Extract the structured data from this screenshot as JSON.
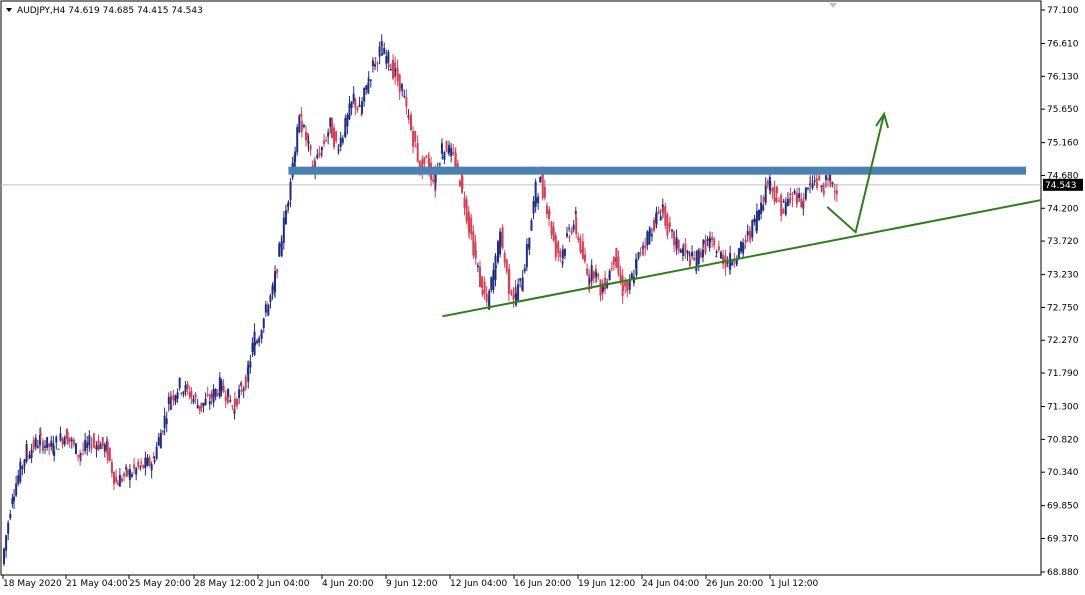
{
  "header": {
    "symbol_line": "AUDJPY,H4  74.619 74.685 74.415 74.543"
  },
  "chart_data": {
    "type": "candlestick",
    "symbol": "AUDJPY",
    "timeframe": "H4",
    "ohlc": {
      "open": 74.619,
      "high": 74.685,
      "low": 74.415,
      "close": 74.543
    },
    "current_price": 74.543,
    "current_price_label": "74.543",
    "y_ticks": [
      "77.100",
      "76.610",
      "76.130",
      "75.650",
      "75.160",
      "74.680",
      "74.200",
      "73.720",
      "73.230",
      "72.750",
      "72.270",
      "71.790",
      "71.300",
      "70.820",
      "70.340",
      "69.850",
      "69.370",
      "68.880"
    ],
    "ylim": [
      68.88,
      77.1
    ],
    "x_ticks": [
      "18 May 2020",
      "21 May 04:00",
      "25 May 20:00",
      "28 May 12:00",
      "2 Jun 04:00",
      "4 Jun 20:00",
      "9 Jun 12:00",
      "12 Jun 04:00",
      "16 Jun 20:00",
      "19 Jun 12:00",
      "24 Jun 04:00",
      "26 Jun 20:00",
      "1 Jul 12:00"
    ],
    "close_path": [
      [
        0,
        69.0
      ],
      [
        6,
        70.0
      ],
      [
        14,
        70.6
      ],
      [
        22,
        70.8
      ],
      [
        30,
        70.7
      ],
      [
        38,
        70.9
      ],
      [
        46,
        70.6
      ],
      [
        54,
        70.8
      ],
      [
        62,
        70.7
      ],
      [
        68,
        70.2
      ],
      [
        74,
        70.3
      ],
      [
        82,
        70.4
      ],
      [
        90,
        70.5
      ],
      [
        96,
        71.0
      ],
      [
        100,
        71.4
      ],
      [
        106,
        71.6
      ],
      [
        112,
        71.5
      ],
      [
        118,
        71.3
      ],
      [
        124,
        71.4
      ],
      [
        130,
        71.6
      ],
      [
        134,
        71.5
      ],
      [
        138,
        71.3
      ],
      [
        142,
        71.5
      ],
      [
        146,
        71.7
      ],
      [
        150,
        72.2
      ],
      [
        154,
        72.4
      ],
      [
        158,
        72.7
      ],
      [
        162,
        73.0
      ],
      [
        166,
        73.6
      ],
      [
        170,
        74.2
      ],
      [
        174,
        74.9
      ],
      [
        178,
        75.5
      ],
      [
        182,
        75.2
      ],
      [
        186,
        74.8
      ],
      [
        190,
        75.0
      ],
      [
        196,
        75.4
      ],
      [
        200,
        75.1
      ],
      [
        204,
        75.3
      ],
      [
        210,
        75.8
      ],
      [
        214,
        75.6
      ],
      [
        218,
        76.0
      ],
      [
        222,
        76.3
      ],
      [
        226,
        76.5
      ],
      [
        230,
        76.4
      ],
      [
        234,
        76.2
      ],
      [
        238,
        76.0
      ],
      [
        242,
        75.6
      ],
      [
        246,
        75.2
      ],
      [
        250,
        74.8
      ],
      [
        254,
        74.9
      ],
      [
        258,
        74.6
      ],
      [
        262,
        75.0
      ],
      [
        266,
        75.1
      ],
      [
        270,
        74.9
      ],
      [
        274,
        74.6
      ],
      [
        278,
        74.1
      ],
      [
        282,
        73.6
      ],
      [
        286,
        73.1
      ],
      [
        290,
        72.8
      ],
      [
        294,
        73.3
      ],
      [
        298,
        73.8
      ],
      [
        302,
        73.2
      ],
      [
        306,
        72.9
      ],
      [
        310,
        73.1
      ],
      [
        314,
        73.6
      ],
      [
        318,
        74.3
      ],
      [
        322,
        74.6
      ],
      [
        326,
        74.2
      ],
      [
        330,
        73.7
      ],
      [
        334,
        73.5
      ],
      [
        338,
        73.8
      ],
      [
        342,
        74.0
      ],
      [
        346,
        73.6
      ],
      [
        350,
        73.2
      ],
      [
        354,
        73.3
      ],
      [
        358,
        73.0
      ],
      [
        362,
        73.2
      ],
      [
        366,
        73.5
      ],
      [
        370,
        73.1
      ],
      [
        374,
        73.0
      ],
      [
        378,
        73.3
      ],
      [
        382,
        73.6
      ],
      [
        386,
        73.8
      ],
      [
        390,
        74.0
      ],
      [
        394,
        74.2
      ],
      [
        398,
        73.9
      ],
      [
        402,
        73.7
      ],
      [
        406,
        73.6
      ],
      [
        410,
        73.5
      ],
      [
        414,
        73.4
      ],
      [
        418,
        73.6
      ],
      [
        422,
        73.7
      ],
      [
        426,
        73.6
      ],
      [
        430,
        73.5
      ],
      [
        434,
        73.4
      ],
      [
        438,
        73.5
      ],
      [
        442,
        73.6
      ],
      [
        446,
        73.8
      ],
      [
        450,
        74.0
      ],
      [
        454,
        74.3
      ],
      [
        458,
        74.6
      ],
      [
        462,
        74.4
      ],
      [
        466,
        74.2
      ],
      [
        470,
        74.3
      ],
      [
        474,
        74.4
      ],
      [
        478,
        74.3
      ],
      [
        482,
        74.5
      ],
      [
        486,
        74.6
      ],
      [
        490,
        74.5
      ],
      [
        494,
        74.6
      ],
      [
        498,
        74.543
      ]
    ],
    "x_index_max": 498,
    "x_index_min": 0,
    "x_index_visible_max": 618,
    "annotations": {
      "resistance_price": 74.75,
      "resistance_start_index": 170,
      "support_points": [
        [
          262,
          72.62
        ],
        [
          618,
          74.32
        ]
      ],
      "arrow_points": [
        [
          492,
          74.22
        ],
        [
          509,
          73.85
        ],
        [
          526,
          75.58
        ]
      ]
    },
    "colors": {
      "bull": "#1f2d80",
      "bear": "#d24155",
      "resistance": "#4a80b2",
      "support": "#2e7d1a",
      "arrow": "#2e7d1a",
      "price_tag": "#000000",
      "price_line": "#c0c0c0"
    }
  }
}
